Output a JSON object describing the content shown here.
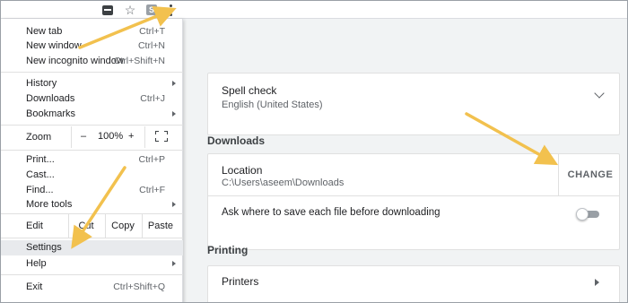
{
  "toolbar": {
    "icons": [
      "extension-icon",
      "star-icon",
      "extension-badge-icon",
      "more-menu-icon"
    ],
    "badge_text": "S"
  },
  "menu": {
    "new_tab": {
      "label": "New tab",
      "shortcut": "Ctrl+T"
    },
    "new_window": {
      "label": "New window",
      "shortcut": "Ctrl+N"
    },
    "new_incognito": {
      "label": "New incognito window",
      "shortcut": "Ctrl+Shift+N"
    },
    "history": {
      "label": "History"
    },
    "downloads": {
      "label": "Downloads",
      "shortcut": "Ctrl+J"
    },
    "bookmarks": {
      "label": "Bookmarks"
    },
    "zoom": {
      "label": "Zoom",
      "minus": "–",
      "value": "100%",
      "plus": "+"
    },
    "print": {
      "label": "Print...",
      "shortcut": "Ctrl+P"
    },
    "cast": {
      "label": "Cast..."
    },
    "find": {
      "label": "Find...",
      "shortcut": "Ctrl+F"
    },
    "more_tools": {
      "label": "More tools"
    },
    "edit": {
      "label": "Edit",
      "cut": "Cut",
      "copy": "Copy",
      "paste": "Paste"
    },
    "settings": {
      "label": "Settings"
    },
    "help": {
      "label": "Help"
    },
    "exit": {
      "label": "Exit",
      "shortcut": "Ctrl+Shift+Q"
    }
  },
  "settings": {
    "spell_check": {
      "title": "Spell check",
      "value": "English (United States)"
    },
    "downloads_heading": "Downloads",
    "location": {
      "title": "Location",
      "value": "C:\\Users\\aseem\\Downloads",
      "button": "CHANGE"
    },
    "ask_where": {
      "title": "Ask where to save each file before downloading",
      "enabled": false
    },
    "printing_heading": "Printing",
    "printers": {
      "title": "Printers"
    }
  },
  "colors": {
    "annotation_arrow": "#f2c14e",
    "settings_bg": "#f1f3f4",
    "highlight": "#e8eaed"
  }
}
